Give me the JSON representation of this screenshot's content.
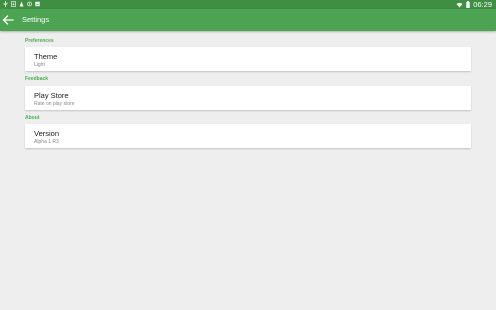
{
  "status_bar": {
    "time": "06:29",
    "icons": [
      "usb-icon",
      "download-icon",
      "warning-icon",
      "settings-icon",
      "image-icon",
      "wifi-icon",
      "battery-icon"
    ]
  },
  "toolbar": {
    "title": "Settings",
    "back_icon": "arrow-left-icon"
  },
  "sections": {
    "preferences": {
      "header": "Preferences",
      "items": [
        {
          "title": "Theme",
          "subtitle": "Light"
        }
      ]
    },
    "feedback": {
      "header": "Feedback",
      "items": [
        {
          "title": "Play Store",
          "subtitle": "Rate on play store"
        }
      ]
    },
    "about": {
      "header": "About",
      "items": [
        {
          "title": "Version",
          "subtitle": "Alpha 1 R3"
        }
      ]
    }
  },
  "colors": {
    "primary": "#4ca351",
    "primary_dark": "#3f8f43",
    "accent_text": "#4caf50",
    "background": "#eeeeee"
  }
}
